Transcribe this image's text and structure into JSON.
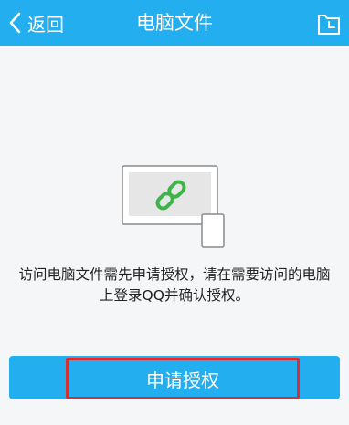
{
  "header": {
    "back_label": "返回",
    "title": "电脑文件",
    "right_icon": "file-icon"
  },
  "illustration": {
    "icon": "pc-link-icon",
    "link_color": "#3cb44a"
  },
  "message": {
    "line1": "访问电脑文件需先申请授权，请在需要访问的电脑",
    "line2": "上登录QQ并确认授权。"
  },
  "action": {
    "button_label": "申请授权"
  },
  "colors": {
    "accent": "#23aef0",
    "highlight_border": "#d63030",
    "background": "#f5f6f8"
  }
}
